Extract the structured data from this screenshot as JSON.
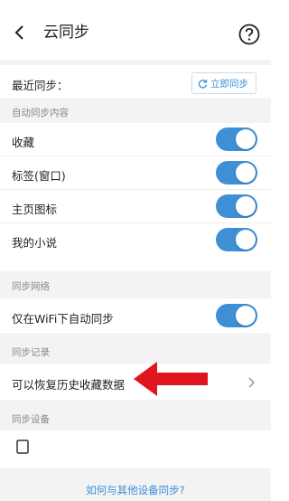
{
  "header": {
    "title": "云同步"
  },
  "recent_sync": {
    "label": "最近同步：",
    "button_label": "立即同步"
  },
  "sections": {
    "auto_sync_content": "自动同步内容",
    "sync_network": "同步网络",
    "sync_records": "同步记录",
    "sync_devices": "同步设备"
  },
  "auto_sync_items": [
    {
      "label": "收藏",
      "enabled": true
    },
    {
      "label": "标签(窗口)",
      "enabled": true
    },
    {
      "label": "主页图标",
      "enabled": true
    },
    {
      "label": "我的小说",
      "enabled": true
    }
  ],
  "network": {
    "wifi_only_label": "仅在WiFi下自动同步",
    "wifi_only_enabled": true
  },
  "records": {
    "restore_label": "可以恢复历史收藏数据"
  },
  "footer": {
    "help_link": "如何与其他设备同步?"
  },
  "colors": {
    "accent": "#3e8fd6",
    "link": "#3a8fd8",
    "annotation_arrow": "#e0161e",
    "section_bg": "#f3f3f3"
  },
  "icons": {
    "back": "chevron-left-icon",
    "help": "question-circle-icon",
    "sync": "refresh-icon",
    "chevron": "chevron-right-icon",
    "device": "phone-icon",
    "annotation": "red-arrow-left-icon"
  }
}
